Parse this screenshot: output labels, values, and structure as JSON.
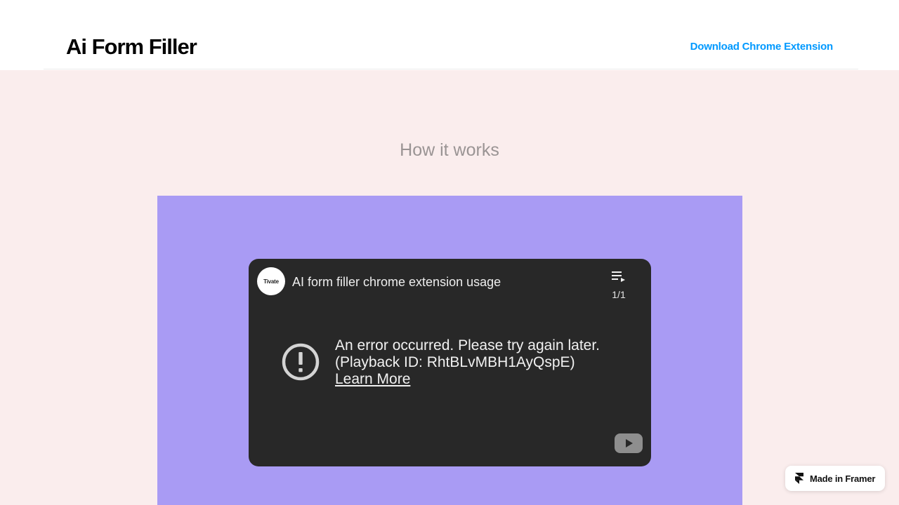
{
  "colors": {
    "page_background": "#faeded",
    "video_panel_background": "#a99bf4",
    "player_background": "#282828",
    "link_color": "#0099ff",
    "section_title_color": "#9a9494"
  },
  "header": {
    "logo_text": "Ai Form Filler",
    "download_link_label": "Download Chrome Extension"
  },
  "main": {
    "section_title": "How it works"
  },
  "video": {
    "channel_avatar_text": "Tivate",
    "title": "AI form filler chrome extension usage",
    "playlist_count": "1/1",
    "error_message": "An error occurred. Please try again later.",
    "playback_id_text": "(Playback ID: RhtBLvMBH1AyQspE)",
    "learn_more_label": "Learn More",
    "icons": {
      "playlist": "playlist-icon",
      "error": "error-exclamation-icon",
      "youtube": "youtube-logo-icon"
    }
  },
  "framer_badge": {
    "label": "Made in Framer",
    "icon": "framer-icon"
  }
}
